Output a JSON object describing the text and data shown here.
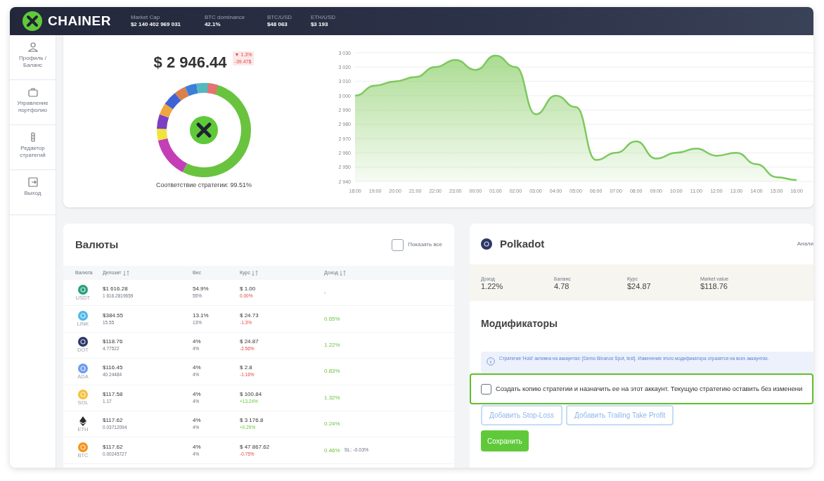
{
  "header": {
    "logo": "CHAINER",
    "stats": [
      {
        "label": "Market Cap",
        "value": "$2 140 402 969 031"
      },
      {
        "label": "BTC dominance",
        "value": "42.1%"
      },
      {
        "label": "BTC/USD",
        "value": "$48 063"
      },
      {
        "label": "ETH/USD",
        "value": "$3 193"
      }
    ]
  },
  "sidebar": {
    "items": [
      {
        "kind": "profile",
        "label": "Профиль / Баланс"
      },
      {
        "kind": "portfolio",
        "label": "Управление портфолио"
      },
      {
        "kind": "editor",
        "label": "Редактор стратегий"
      },
      {
        "kind": "logout",
        "label": "Выход"
      }
    ]
  },
  "balance": {
    "total": "$ 2 946.44",
    "change_percent": "▼ 1.3%",
    "change_value": "-39.47$",
    "match": "Соответствие стратегии: 99.51%"
  },
  "history": {
    "chart_data": {
      "type": "area",
      "categories": [
        "18:00",
        "19:00",
        "20:00",
        "21:00",
        "22:00",
        "23:00",
        "00:00",
        "01:00",
        "02:00",
        "03:00",
        "04:00",
        "05:00",
        "06:00",
        "07:00",
        "08:00",
        "09:00",
        "10:00",
        "11:00",
        "12:00",
        "13:00",
        "14:00",
        "15:00",
        "16:00"
      ],
      "grid": true,
      "series": [
        {
          "color": "#7dc95e",
          "values": [
            3000,
            3007,
            3010,
            3013,
            3020,
            3025,
            3018,
            3028,
            3020,
            2987,
            3000,
            2992,
            2955,
            2960,
            2968,
            2956,
            2960,
            2963,
            2958,
            2960,
            2952,
            2943,
            2941
          ]
        }
      ],
      "ylim": [
        2940,
        3030
      ],
      "yticks": [
        {
          "value": 3030,
          "label": "3 030"
        },
        {
          "value": 3020,
          "label": "3 020"
        },
        {
          "value": 3010,
          "label": "3 010"
        },
        {
          "value": 3000,
          "label": "3 000"
        },
        {
          "value": 2990,
          "label": "2 990"
        },
        {
          "value": 2980,
          "label": "2 980"
        },
        {
          "value": 2970,
          "label": "2 970"
        },
        {
          "value": 2960,
          "label": "2 960"
        },
        {
          "value": 2950,
          "label": "2 950"
        },
        {
          "value": 2940,
          "label": "2 940"
        }
      ]
    }
  },
  "currencies": {
    "title": "Валюты",
    "show_all": {
      "label": "Показать все",
      "checked": false
    },
    "columns": [
      {
        "label": "Валюта",
        "sortable": false
      },
      {
        "label": "Депозит",
        "sortable": true
      },
      {
        "label": "Вес",
        "sortable": false
      },
      {
        "label": "Курс",
        "sortable": true
      },
      {
        "label": "Доход",
        "sortable": true
      }
    ],
    "rows": [
      {
        "kind": "coin",
        "color": "#26a17b",
        "symbol": "USDT",
        "deposit": "$1 616.28",
        "amount": "1 616.2819659",
        "weight": "54.9%",
        "target": "55%",
        "rate": "$ 1.00",
        "rate_change": "0.00%",
        "rising": false,
        "income": "-"
      },
      {
        "kind": "coin",
        "color": "#4fb8ea",
        "symbol": "LINK",
        "deposit": "$384.55",
        "amount": "15.55",
        "weight": "13.1%",
        "target": "13%",
        "rate": "$ 24.73",
        "rate_change": "-1.3%",
        "rising": false,
        "income": "0.65%"
      },
      {
        "kind": "coin",
        "color": "#2c3768",
        "symbol": "DOT",
        "deposit": "$118.76",
        "amount": "4.77522",
        "weight": "4%",
        "target": "4%",
        "rate": "$ 24.87",
        "rate_change": "-2.56%",
        "rising": false,
        "income": "1.22%"
      },
      {
        "kind": "coin",
        "color": "#6f9cf0",
        "symbol": "ADA",
        "deposit": "$116.45",
        "amount": "40.24484",
        "weight": "4%",
        "target": "4%",
        "rate": "$ 2.8",
        "rate_change": "-1.16%",
        "rising": false,
        "income": "0.83%"
      },
      {
        "kind": "coin",
        "color": "#f5c13d",
        "symbol": "SOL",
        "deposit": "$117.58",
        "amount": "1.17",
        "weight": "4%",
        "target": "4%",
        "rate": "$ 100.84",
        "rate_change": "+13.24%",
        "rising": true,
        "income": "1.32%"
      },
      {
        "kind": "diamond",
        "color": "#2a2a2a",
        "symbol": "ETH",
        "deposit": "$117.62",
        "amount": "0.03712094",
        "weight": "4%",
        "target": "4%",
        "rate": "$ 3 176.8",
        "rate_change": "+0.29%",
        "rising": true,
        "income": "0.24%"
      },
      {
        "kind": "coin",
        "color": "#f7931a",
        "symbol": "BTC",
        "deposit": "$117.62",
        "amount": "0.00245727",
        "weight": "4%",
        "target": "4%",
        "rate": "$ 47 867.62",
        "rate_change": "-0.75%",
        "rising": false,
        "income": "0.46%",
        "note": "SL: -0.03%"
      }
    ]
  },
  "asset": {
    "name": "Polkadot",
    "tab": "Анали",
    "stats": [
      {
        "label": "Доход",
        "value": "1.22%"
      },
      {
        "label": "Баланс",
        "value": "4.78"
      },
      {
        "label": "Курс",
        "value": "$24.87"
      },
      {
        "label": "Market value",
        "value": "$118.76"
      }
    ],
    "modifiers_title": "Модификаторы",
    "info": "Стратегия 'Hold' активна на аккаунтах: [Demo Binance Spot, test]. Изменения этого модификатора отразятся на всех аккаунтах.",
    "copy_option": {
      "label": "Создать копию стратегии и назначить ее на этот аккаунт. Текущую стратегию оставить без изменени",
      "checked": false,
      "highlighted": true
    },
    "buttons": [
      {
        "kind": "outline",
        "label": "Добавить Stop-Loss"
      },
      {
        "kind": "outline",
        "label": "Добавить Trailing Take Profit"
      },
      {
        "kind": "primary",
        "label": "Сохранить"
      }
    ]
  }
}
